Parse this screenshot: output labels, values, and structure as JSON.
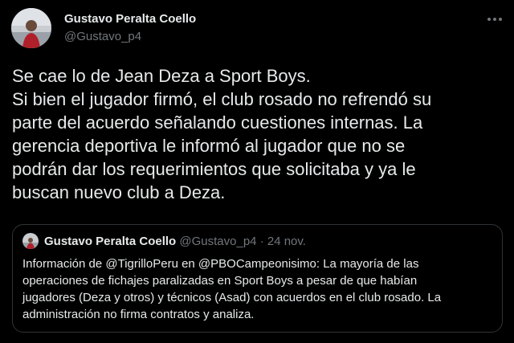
{
  "tweet": {
    "author": {
      "name": "Gustavo Peralta Coello",
      "handle": "@Gustavo_p4"
    },
    "text_lines": [
      "Se cae lo de Jean Deza a Sport Boys.",
      "Si bien el jugador firmó, el club rosado no refrendó su",
      "parte del acuerdo señalando cuestiones internas. La",
      "gerencia deportiva le informó al jugador que no se",
      "podrán dar los requerimientos que solicitaba y ya le",
      "buscan nuevo club a Deza."
    ]
  },
  "quote": {
    "author": {
      "name": "Gustavo Peralta Coello",
      "handle": "@Gustavo_p4"
    },
    "separator": "·",
    "date": "24 nov.",
    "text_lines": [
      "Información de @TigrilloPeru en @PBOCampeonisimo: La mayoría de las",
      "operaciones de fichajes paralizadas en Sport Boys a pesar de que habían",
      "jugadores (Deza y otros) y técnicos (Asad) con acuerdos en el club rosado. La",
      "administración no firma contratos y analiza."
    ]
  },
  "icons": {
    "more": "more-horizontal-icon",
    "avatar": "profile-photo"
  },
  "colors": {
    "background": "#000000",
    "text_primary": "#e7e9ea",
    "text_secondary": "#71767b",
    "border": "#2f3336"
  }
}
